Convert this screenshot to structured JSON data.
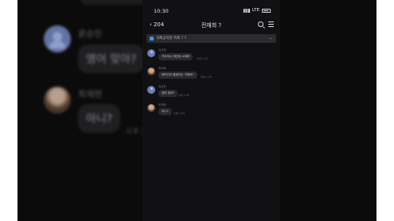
{
  "background_view": {
    "top_fragment": "",
    "rows": [
      {
        "name": "윤승민",
        "message": "영어 맞아?",
        "time": ""
      },
      {
        "name": "최재현",
        "message": "아니?",
        "time": "오후 1"
      }
    ]
  },
  "status_bar": {
    "time": "10:30",
    "network": "LTE"
  },
  "chat_header": {
    "back_count": "204",
    "title": "전재희 ?"
  },
  "notice": {
    "text": "과제공지한 목표 ? ?"
  },
  "messages": [
    {
      "sender": "유성한",
      "text": "가이아나 재단입 소재하",
      "time": "오후 1:33",
      "avatar": "default"
    },
    {
      "sender": "최재현",
      "text": "버미디아 통한다는 거예요?",
      "time": "오후 1:33",
      "avatar": "photo"
    },
    {
      "sender": "유성한",
      "text": "영어 맞아?",
      "time": "오후 1:33",
      "avatar": "default"
    },
    {
      "sender": "최재현",
      "text": "아니?",
      "time": "오후 1:33",
      "avatar": "photo"
    }
  ],
  "icons": [
    "back-chevron-icon",
    "search-icon",
    "menu-icon",
    "notice-icon",
    "chevron-down-icon",
    "signal-icon",
    "battery-icon"
  ]
}
